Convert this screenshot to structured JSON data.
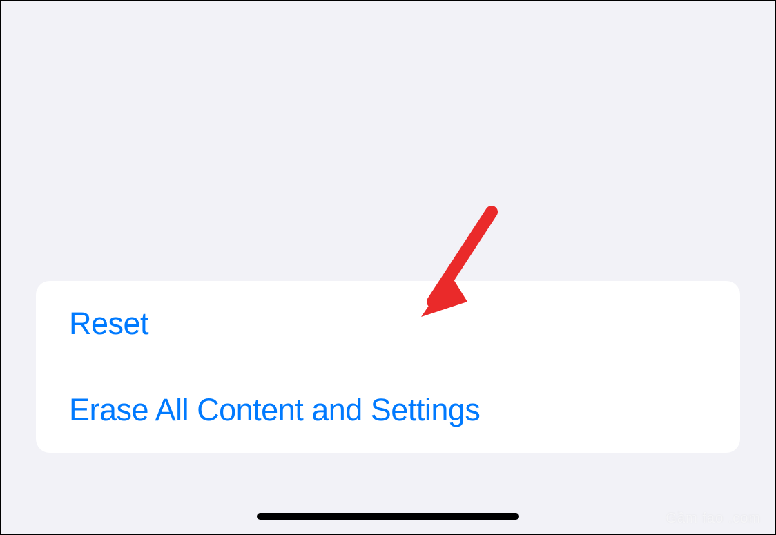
{
  "settings": {
    "items": [
      {
        "label": "Reset"
      },
      {
        "label": "Erase All Content and Settings"
      }
    ]
  },
  "watermark": "Gầm fao .com"
}
